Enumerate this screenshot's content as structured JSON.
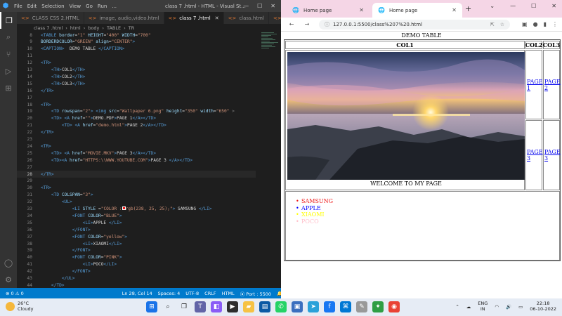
{
  "vscode": {
    "menu": [
      "File",
      "Edit",
      "Selection",
      "View",
      "Go",
      "Run",
      "..."
    ],
    "title": "class 7 .html - HTML - Visual St...",
    "tabs": [
      {
        "label": "CLASS CSS 2.HTML",
        "active": false
      },
      {
        "label": "image, audio,video.html",
        "active": false
      },
      {
        "label": "class 7 .html",
        "active": true
      },
      {
        "label": "class.html",
        "active": false
      },
      {
        "label": "cla",
        "active": false
      }
    ],
    "breadcrumb": [
      "class 7 .html",
      "html",
      "body",
      "TABLE",
      "TR"
    ],
    "lines": [
      {
        "n": "8",
        "html": "<span class='t'>&lt;TABLE</span> <span class='a'>border</span>=<span class='s'>\"1\"</span> <span class='a'>HEIGHT</span>=<span class='s'>\"400\"</span> <span class='a'>WIDTH</span>=<span class='s'>\"700\"</span>"
      },
      {
        "n": "9",
        "html": "<span class='a'>BORDERDCOLOR</span>=<span class='s'>\"GREEN\"</span> <span class='a'>align</span>=<span class='s'>\"CENTER\"</span><span class='t'>&gt;</span>"
      },
      {
        "n": "10",
        "html": "<span class='t'>&lt;CAPTION&gt;</span>  DEMO TABLE <span class='t'>&lt;/CAPTION&gt;</span>"
      },
      {
        "n": "11",
        "html": ""
      },
      {
        "n": "12",
        "html": "<span class='t'>&lt;TR&gt;</span>"
      },
      {
        "n": "13",
        "html": "    <span class='t'>&lt;TH&gt;</span>COL1<span class='t'>&lt;/TH&gt;</span>"
      },
      {
        "n": "14",
        "html": "    <span class='t'>&lt;TH&gt;</span>COL2<span class='t'>&lt;/TH&gt;</span>"
      },
      {
        "n": "15",
        "html": "    <span class='t'>&lt;TH&gt;</span>COL3<span class='t'>&lt;/TH&gt;</span>"
      },
      {
        "n": "16",
        "html": "<span class='t'>&lt;/TR&gt;</span>"
      },
      {
        "n": "17",
        "html": ""
      },
      {
        "n": "18",
        "html": "<span class='t'>&lt;TR&gt;</span>"
      },
      {
        "n": "19",
        "html": "    <span class='t'>&lt;TD</span> <span class='a'>rowspan</span>=<span class='s'>\"2\"</span><span class='t'>&gt;</span> <span class='t'>&lt;img</span> <span class='a'>src</span>=<span class='s'>\"Wallpaper 6.png\"</span> <span class='a'>height</span>=<span class='s'>\"350\"</span> <span class='a'>width</span>=<span class='s'>\"650\"</span> <span class='p'>&gt;</span>"
      },
      {
        "n": "20",
        "html": "    <span class='t'>&lt;TD&gt;</span> <span class='t'>&lt;A</span> <span class='a'>href</span>=<span class='s'>\"\"</span><span class='t'>&gt;</span>DEMO.PDF<span class='t'>&gt;</span>PAGE 1<span class='t'>&lt;/A&gt;&lt;/TD&gt;</span>"
      },
      {
        "n": "21",
        "html": "        <span class='t'>&lt;TD&gt;</span> <span class='t'>&lt;A</span> <span class='a'>href</span>=<span class='s'>\"demo.html\"</span><span class='t'>&gt;</span>PAGE 2<span class='t'>&lt;/A&gt;&lt;/TD&gt;</span>"
      },
      {
        "n": "22",
        "html": "<span class='t'>&lt;/TR&gt;</span>"
      },
      {
        "n": "23",
        "html": ""
      },
      {
        "n": "24",
        "html": "<span class='t'>&lt;TR&gt;</span>"
      },
      {
        "n": "25",
        "html": "    <span class='t'>&lt;TD&gt;</span> <span class='t'>&lt;A</span> <span class='a'>href</span>=<span class='s'>\"MOVIE.MKV\"</span><span class='t'>&gt;</span>PAGE 3<span class='t'>&lt;/A&gt;&lt;/TD&gt;</span>"
      },
      {
        "n": "26",
        "html": "    <span class='t'>&lt;TD&gt;</span><span class='t'>&lt;A</span> <span class='a'>href</span>=<span class='s'>\"HTTPS:\\\\WWW.YOUTUBE.COM\"</span><span class='t'>&gt;</span>PAGE 3 <span class='t'>&lt;/A&gt;&lt;/TD&gt;</span>"
      },
      {
        "n": "27",
        "html": ""
      },
      {
        "n": "28",
        "html": "<span class='t'>&lt;/TR&gt;</span>",
        "current": true
      },
      {
        "n": "29",
        "html": ""
      },
      {
        "n": "30",
        "html": "<span class='t'>&lt;TR&gt;</span>"
      },
      {
        "n": "31",
        "html": "    <span class='t'>&lt;TD</span> <span class='a'>COLSPAN</span>=<span class='s'>\"3\"</span><span class='t'>&gt;</span>"
      },
      {
        "n": "32",
        "html": "        <span class='t'>&lt;UL&gt;</span>"
      },
      {
        "n": "33",
        "html": "            <span class='t'>&lt;LI</span> <span class='a'>STYLE</span> =<span class='s'>\"COLOR :</span><span style='display:inline-block;width:5px;height:5px;background:#ee1919;border:1px solid #fff;'></span><span class='s'>rgb(238, 25, 25);\"</span><span class='t'>&gt;</span> SAMSUNG <span class='t'>&lt;/LI&gt;</span>"
      },
      {
        "n": "34",
        "html": "            <span class='t'>&lt;FONT</span> <span class='a'>COLOR</span>=<span class='s'>\"BLUE\"</span><span class='t'>&gt;</span>"
      },
      {
        "n": "35",
        "html": "                <span class='t'>&lt;LI&gt;</span>APPLE <span class='t'>&lt;/LI&gt;</span>"
      },
      {
        "n": "36",
        "html": "            <span class='t'>&lt;/FONT&gt;</span>"
      },
      {
        "n": "37",
        "html": "            <span class='t'>&lt;FONT</span> <span class='a'>COLOR</span>=<span class='s'>\"yellow\"</span><span class='t'>&gt;</span>"
      },
      {
        "n": "38",
        "html": "                <span class='t'>&lt;LI&gt;</span>XIAOMI<span class='t'>&lt;/LI&gt;</span>"
      },
      {
        "n": "39",
        "html": "            <span class='t'>&lt;/FONT&gt;</span>"
      },
      {
        "n": "40",
        "html": "            <span class='t'>&lt;FONT</span> <span class='a'>COLOR</span>=<span class='s'>\"PINK\"</span><span class='t'>&gt;</span>"
      },
      {
        "n": "41",
        "html": "                <span class='t'>&lt;LI&gt;</span>POCO<span class='t'>&lt;/LI&gt;</span>"
      },
      {
        "n": "42",
        "html": "            <span class='t'>&lt;/FONT&gt;</span>"
      },
      {
        "n": "43",
        "html": "        <span class='t'>&lt;/UL&gt;</span>"
      },
      {
        "n": "44",
        "html": "    <span class='t'>&lt;/TD&gt;</span>"
      }
    ],
    "status": {
      "errors": "⊗ 0 ⚠ 0",
      "position": "Ln 28, Col 14",
      "spaces": "Spaces: 4",
      "encoding": "UTF-8",
      "eol": "CRLF",
      "language": "HTML",
      "port": "⦿ Port : 5500"
    }
  },
  "chrome": {
    "tabs": [
      {
        "label": "Home page",
        "active": false
      },
      {
        "label": "Home page",
        "active": true
      }
    ],
    "url": "127.0.0.1:5500/class%207%20.html",
    "page": {
      "caption": "DEMO TABLE",
      "headers": [
        "COL1",
        "COL2",
        "COL3"
      ],
      "welcome": "WELCOME TO MY PAGE",
      "links": [
        "PAGE 1",
        "PAGE 2",
        "PAGE 3",
        "PAGE 3"
      ],
      "list": [
        {
          "text": "SAMSUNG",
          "color": "#ee1919"
        },
        {
          "text": "APPLE",
          "color": "#0000ff"
        },
        {
          "text": "XIAOMI",
          "color": "#ffff00"
        },
        {
          "text": "POCO",
          "color": "#ffc0cb"
        }
      ]
    }
  },
  "taskbar": {
    "temp": "26°C",
    "weather": "Cloudy",
    "lang1": "ENG",
    "lang2": "IN",
    "time": "22:18",
    "date": "06-10-2022"
  }
}
